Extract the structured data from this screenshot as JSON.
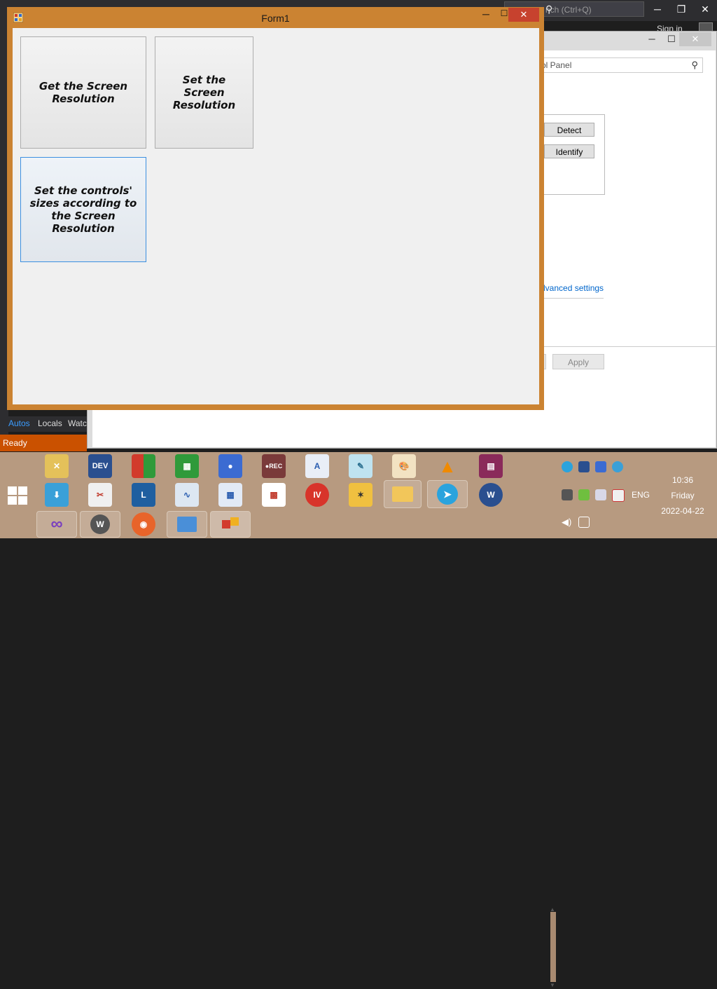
{
  "vs": {
    "search_placeholder": "Quick Launch (Ctrl+Q)",
    "search_visible": "nch (Ctrl+Q)",
    "sign_in": "Sign in",
    "tabs": [
      "Autos",
      "Locals",
      "Watc"
    ],
    "status": "Ready",
    "min_glyph": "─",
    "max_glyph": "❐",
    "close_glyph": "✕"
  },
  "control_panel": {
    "search_text": "ol Panel",
    "detect_label": "Detect",
    "identify_label": "Identify",
    "advanced_link": "dvanced settings",
    "apply_label": "Apply",
    "min_glyph": "─",
    "max_glyph": "☐",
    "close_glyph": "✕"
  },
  "form": {
    "title": "Form1",
    "min_glyph": "─",
    "max_glyph": "☐",
    "close_glyph": "✕",
    "buttons": {
      "get_resolution": "Get the Screen Resolution",
      "set_resolution": "Set the Screen Resolution",
      "set_controls": "Set the controls' sizes according to the Screen Resolution"
    }
  },
  "taskbar": {
    "language": "ENG",
    "time": "10:36",
    "day": "Friday",
    "date": "2022-04-22",
    "dev_label": "DEV"
  },
  "colors": {
    "form_border": "#cb8332",
    "form_close": "#c7422e",
    "taskbar": "#b79a80",
    "vs_status": "#ca5100",
    "link": "#0066cc"
  }
}
